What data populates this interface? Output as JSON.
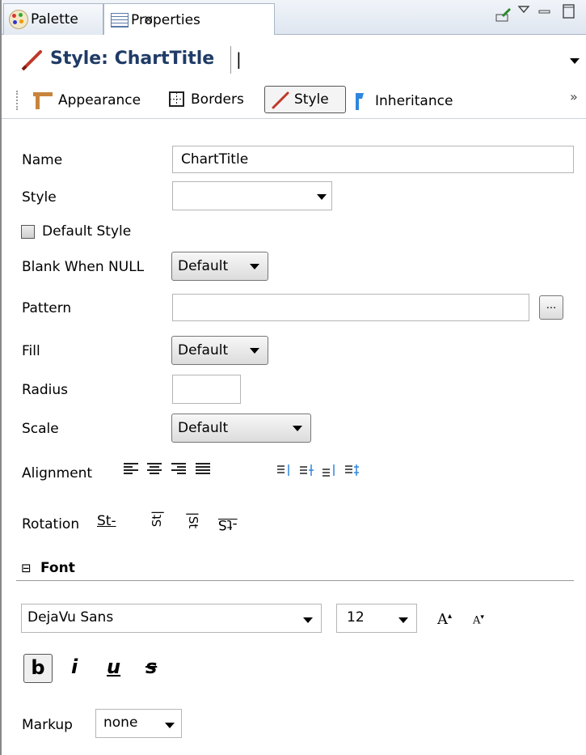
{
  "tabs": {
    "palette_label": "Palette",
    "properties_label": "Properties",
    "close_glyph": "✕"
  },
  "header": {
    "title": "Style: ChartTitle",
    "combo_value": "|"
  },
  "toolbar": {
    "appearance_label": "Appearance",
    "borders_label": "Borders",
    "style_label": "Style",
    "inheritance_label": "Inheritance",
    "overflow_glyph": "»"
  },
  "form": {
    "name_label": "Name",
    "name_value": "ChartTitle",
    "style_label": "Style",
    "style_value": "",
    "default_style_label": "Default Style",
    "default_style_checked": false,
    "blank_when_null_label": "Blank When NULL",
    "blank_when_null_value": "Default",
    "pattern_label": "Pattern",
    "pattern_value": "",
    "pattern_button_label": "...",
    "fill_label": "Fill",
    "fill_value": "Default",
    "radius_label": "Radius",
    "radius_value": "",
    "scale_label": "Scale",
    "scale_value": "Default",
    "alignment_label": "Alignment",
    "rotation_label": "Rotation",
    "rotation_options": [
      "St-",
      "St|",
      "|St",
      "-tS"
    ]
  },
  "font_section": {
    "toggle_glyph": "⊟",
    "title": "Font",
    "family_value": "DejaVu Sans",
    "size_value": "12",
    "increase_label": "A",
    "decrease_label": "A",
    "bold_label": "b",
    "italic_label": "i",
    "underline_label": "u",
    "strike_label": "s",
    "markup_label": "Markup",
    "markup_value": "none"
  }
}
